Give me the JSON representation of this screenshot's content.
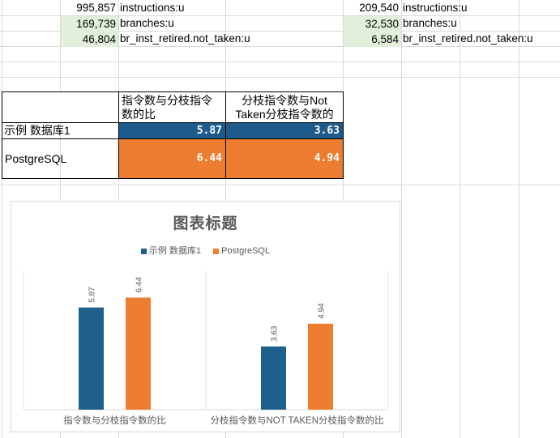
{
  "sheet": {
    "left_block": [
      {
        "value": "995,857",
        "label": "instructions:u",
        "highlight": false
      },
      {
        "value": "169,739",
        "label": "branches:u",
        "highlight": true
      },
      {
        "value": "46,804",
        "label": "br_inst_retired.not_taken:u",
        "highlight": true
      }
    ],
    "right_block": [
      {
        "value": "209,540",
        "label": "instructions:u",
        "highlight": false
      },
      {
        "value": "32,530",
        "label": "branches:u",
        "highlight": true
      },
      {
        "value": "6,584",
        "label": "br_inst_retired.not_taken:u",
        "highlight": true
      }
    ]
  },
  "table": {
    "col1_header": "指令数与分枝指令数的比",
    "col2_header": "分枝指令数与Not Taken分枝指令数的",
    "rows": [
      {
        "label": "示例 数据库1",
        "v1": "5.87",
        "v2": "3.63",
        "color": "#1f5b8a"
      },
      {
        "label": "PostgreSQL",
        "v1": "6.44",
        "v2": "4.94",
        "color": "#ed7d31"
      }
    ]
  },
  "chart_data": {
    "type": "bar",
    "title": "图表标题",
    "categories": [
      "指令数与分枝指令数的比",
      "分枝指令数与NOT TAKEN分枝指令数的比"
    ],
    "series": [
      {
        "name": "示例 数据库1",
        "values": [
          5.87,
          3.63
        ],
        "color": "#1f5f8b"
      },
      {
        "name": "PostgreSQL",
        "values": [
          6.44,
          4.94
        ],
        "color": "#ed7d31"
      }
    ],
    "ylim": [
      0,
      8
    ],
    "legend": "top",
    "grid": false
  }
}
